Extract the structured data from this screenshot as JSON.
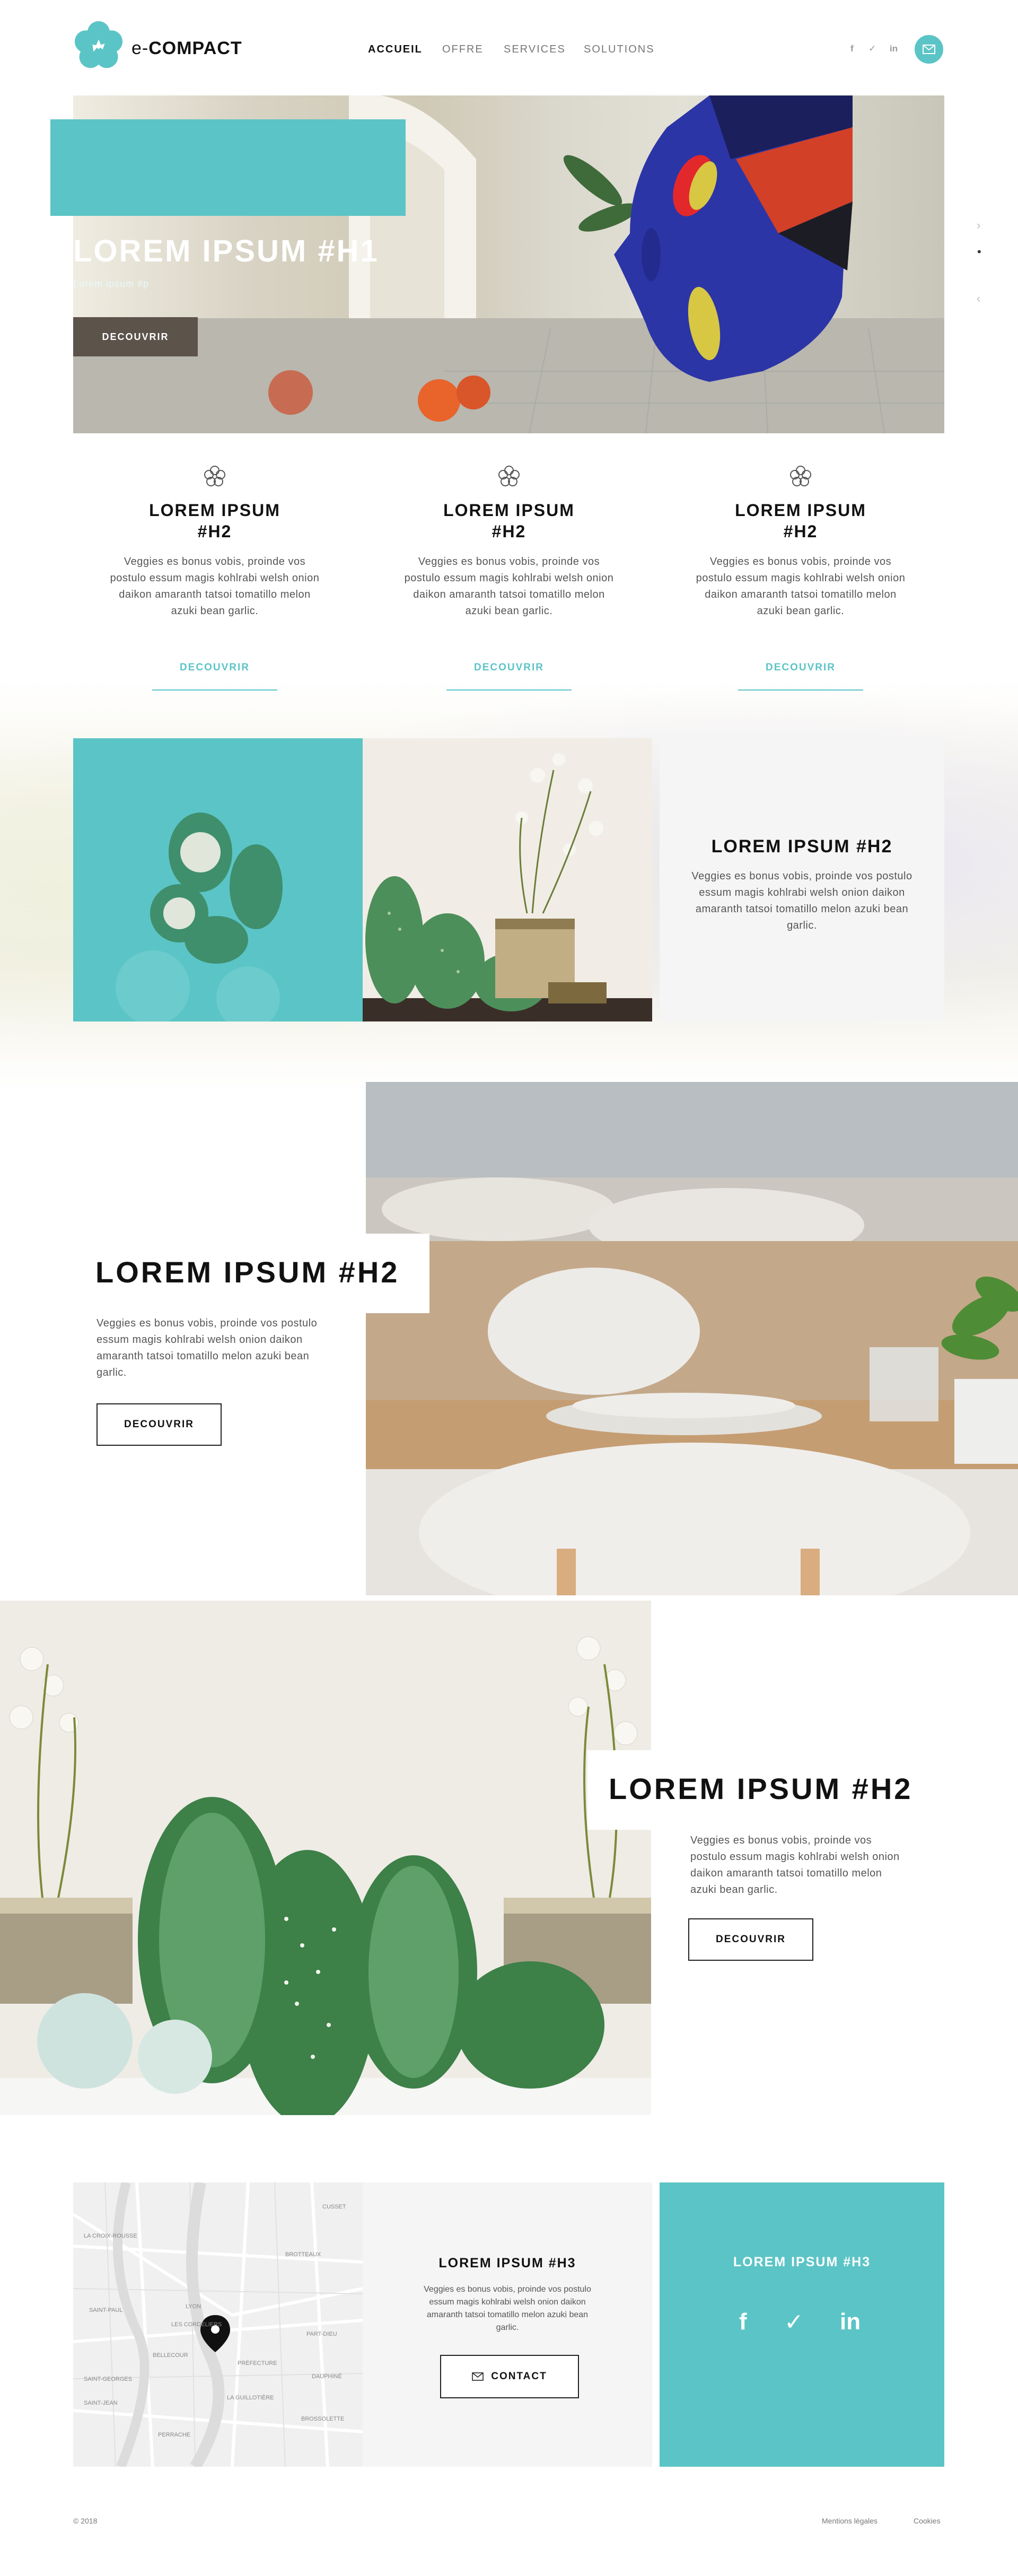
{
  "brand": {
    "name_prefix": "e-",
    "name_main": "COMPACT"
  },
  "nav": [
    {
      "label": "ACCUEIL",
      "active": true
    },
    {
      "label": "OFFRE"
    },
    {
      "label": "SERVICES"
    },
    {
      "label": "SOLUTIONS"
    }
  ],
  "header_social": {
    "facebook": "f",
    "twitter": "✓",
    "linkedin": "in",
    "mail_icon": "mail-icon"
  },
  "hero": {
    "title": "LOREM IPSUM #H1",
    "subtitle": "Lorem ipsum #p",
    "button": "DECOUVRIR"
  },
  "slider_controls": {
    "next": "›",
    "prev": "‹",
    "dot": "•"
  },
  "features": [
    {
      "title": "LOREM IPSUM\n#H2",
      "text": "Veggies es bonus vobis, proinde vos postulo essum magis kohlrabi welsh onion daikon amaranth tatsoi tomatillo melon azuki bean garlic.",
      "link": "DECOUVRIR"
    },
    {
      "title": "LOREM IPSUM\n#H2",
      "text": "Veggies es bonus vobis, proinde vos postulo essum magis kohlrabi welsh onion daikon amaranth tatsoi tomatillo melon azuki bean garlic.",
      "link": "DECOUVRIR"
    },
    {
      "title": "LOREM IPSUM\n#H2",
      "text": "Veggies es bonus vobis, proinde vos postulo essum magis kohlrabi welsh onion daikon amaranth tatsoi tomatillo melon azuki bean garlic.",
      "link": "DECOUVRIR"
    }
  ],
  "card_block": {
    "title": "LOREM IPSUM #H2",
    "text": "Veggies es bonus vobis, proinde vos postulo essum magis kohlrabi welsh onion daikon amaranth tatsoi tomatillo melon azuki bean garlic."
  },
  "section_restaurant": {
    "title": "LOREM IPSUM #H2",
    "text": "Veggies es bonus vobis, proinde vos postulo essum magis kohlrabi welsh onion daikon amaranth tatsoi tomatillo melon azuki bean garlic.",
    "button": "DECOUVRIR"
  },
  "section_cactus": {
    "title": "LOREM IPSUM #H2",
    "text": "Veggies es bonus vobis, proinde vos postulo essum magis kohlrabi welsh onion daikon amaranth tatsoi tomatillo melon azuki bean garlic.",
    "button": "DECOUVRIR"
  },
  "contact": {
    "title": "LOREM IPSUM #H3",
    "text": "Veggies es bonus vobis, proinde vos postulo essum magis kohlrabi welsh onion daikon amaranth tatsoi tomatillo melon azuki bean garlic.",
    "button": "CONTACT"
  },
  "social_block": {
    "title": "LOREM IPSUM #H3",
    "facebook": "f",
    "twitter": "✓",
    "linkedin": "in"
  },
  "map_labels": [
    "LA CROIX-ROUSSE",
    "SAINT-PAUL",
    "LYON",
    "LES CORDELIERS",
    "BELLECOUR",
    "LA GUILLOTIÈRE",
    "PRÉFECTURE",
    "PART-DIEU",
    "BROTTEAUX",
    "PERRACHE",
    "SAINT-GEORGES",
    "SAINT-JEAN",
    "BROSSOLETTE",
    "DAUPHINÉ",
    "CUSSET"
  ],
  "footer": {
    "copyright": "© 2018",
    "legal": "Mentions légales",
    "cookies": "Cookies"
  },
  "colors": {
    "accent": "#5bc4c6",
    "dark_button": "#5c534b"
  }
}
